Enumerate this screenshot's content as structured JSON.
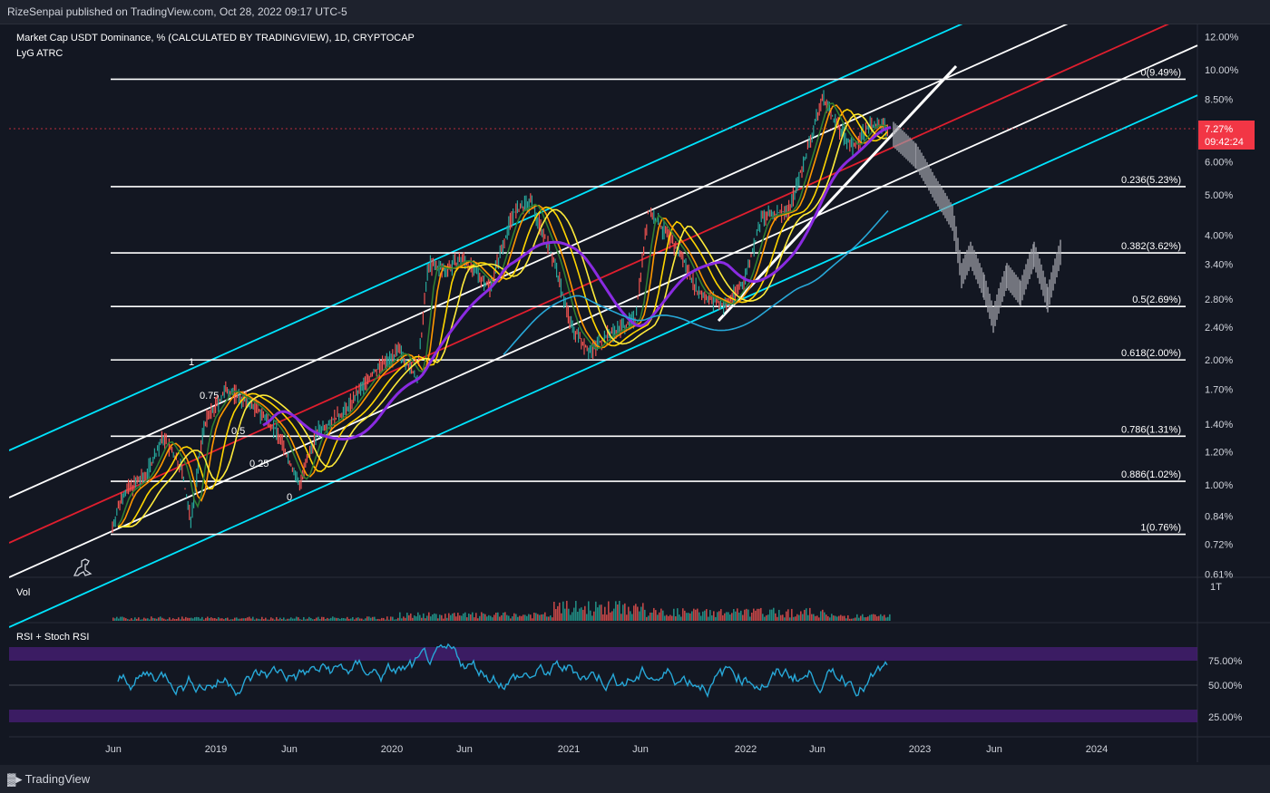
{
  "header": {
    "published": "RizeSenpai published on TradingView.com, Oct 28, 2022 09:17 UTC-5"
  },
  "footer": {
    "brand": "TradingView",
    "brand_mark": "17"
  },
  "chart": {
    "title": "Market Cap USDT Dominance, % (CALCULATED BY TRADINGVIEW), 1D, CRYPTOCAP",
    "indicator": "LyG ATRC",
    "price_badge": {
      "value": "7.27%",
      "countdown": "09:42:24",
      "color": "#f23645"
    },
    "vol_label": "Vol",
    "vol_scale": "1T",
    "rsi_label": "RSI + Stoch RSI",
    "colors": {
      "white": "#ffffff",
      "cyan": "#00e5ff",
      "red": "#e01e2e",
      "purple": "#8a2be2",
      "rsi": "#27a8d8"
    }
  },
  "chart_data": {
    "type": "line",
    "y_scale": "log",
    "y_ticks": [
      "12.00%",
      "10.00%",
      "8.50%",
      "6.00%",
      "5.00%",
      "4.00%",
      "3.40%",
      "2.80%",
      "2.40%",
      "2.00%",
      "1.70%",
      "1.40%",
      "1.20%",
      "1.00%",
      "0.84%",
      "0.72%",
      "0.61%"
    ],
    "x_ticks": [
      "Jun",
      "2019",
      "Jun",
      "2020",
      "Jun",
      "2021",
      "Jun",
      "2022",
      "Jun",
      "2023",
      "Jun",
      "2024"
    ],
    "fib_levels": [
      {
        "label": "0(9.49%)",
        "value": 9.49
      },
      {
        "label": "0.236(5.23%)",
        "value": 5.23
      },
      {
        "label": "0.382(3.62%)",
        "value": 3.62
      },
      {
        "label": "0.5(2.69%)",
        "value": 2.69
      },
      {
        "label": "0.618(2.00%)",
        "value": 2.0
      },
      {
        "label": "0.786(1.31%)",
        "value": 1.31
      },
      {
        "label": "0.886(1.02%)",
        "value": 1.02
      },
      {
        "label": "1(0.76%)",
        "value": 0.76
      }
    ],
    "channel_labels": [
      "1",
      "0.75",
      "0.5",
      "0.25",
      "0"
    ],
    "rsi_ticks": [
      "75.00%",
      "50.00%",
      "25.00%"
    ],
    "last_value": 7.27
  }
}
